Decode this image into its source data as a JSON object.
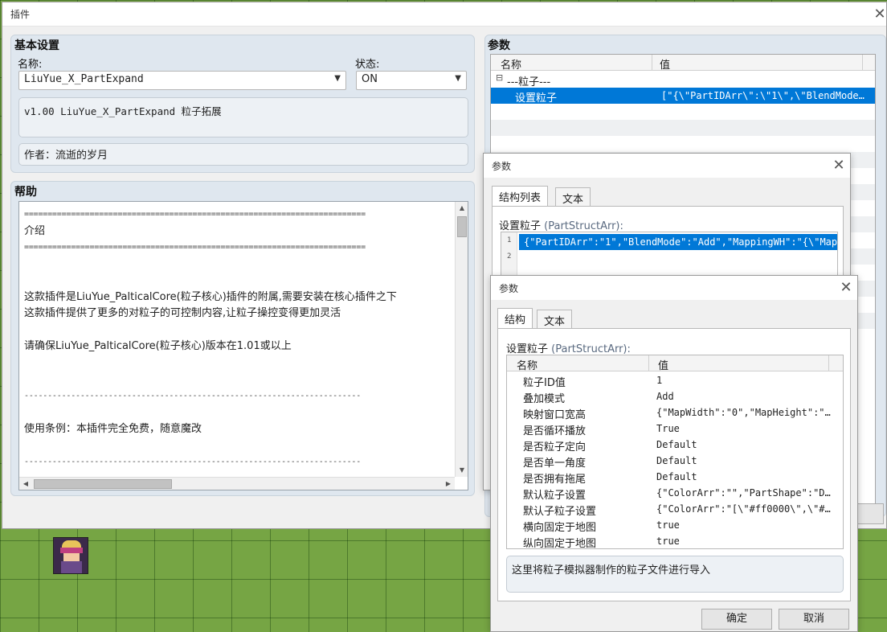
{
  "main_window": {
    "title": "插件",
    "basic": {
      "title": "基本设置",
      "name_label": "名称:",
      "name_value": "LiuYue_X_PartExpand",
      "status_label": "状态:",
      "status_value": "ON",
      "description": "v1.00 LiuYue_X_PartExpand 粒子拓展",
      "author": "作者：流逝的岁月"
    },
    "help": {
      "title": "帮助",
      "lines": [
        "=========================================================================",
        "介绍",
        "=========================================================================",
        "",
        "",
        "这款插件是LiuYue_PalticalCore(粒子核心)插件的附属,需要安装在核心插件之下",
        "这款插件提供了更多的对粒子的可控制内容,让粒子操控变得更加灵活",
        "",
        "请确保LiuYue_PalticalCore(粒子核心)版本在1.01或以上",
        "",
        "",
        "------------------------------------------------------------------------",
        "",
        "使用条例：本插件完全免费，随意魔改",
        "",
        "------------------------------------------------------------------------"
      ]
    },
    "params": {
      "title": "参数",
      "col_name": "名称",
      "col_value": "值",
      "group_label": "---粒子---",
      "group_toggle": "⊟",
      "row_name": "设置粒子",
      "row_value": "[\"{\\\"PartIDArr\\\":\\\"1\\\",\\\"BlendMode…"
    }
  },
  "dialog1": {
    "title": "参数",
    "tabs": [
      "结构列表",
      "文本"
    ],
    "field_label": "设置粒子",
    "field_type": "(PartStructArr):",
    "list": [
      {
        "num": "1",
        "text": "{\"PartIDArr\":\"1\",\"BlendMode\":\"Add\",\"MappingWH\":\"{\\\"Map…"
      },
      {
        "num": "2",
        "text": ""
      }
    ]
  },
  "dialog2": {
    "title": "参数",
    "tabs": [
      "结构",
      "文本"
    ],
    "field_label": "设置粒子",
    "field_type": "(PartStructArr):",
    "col_name": "名称",
    "col_value": "值",
    "rows": [
      {
        "name": "粒子ID值",
        "value": "1"
      },
      {
        "name": "叠加模式",
        "value": "Add"
      },
      {
        "name": "映射窗口宽高",
        "value": "{\"MapWidth\":\"0\",\"MapHeight\":\"…"
      },
      {
        "name": "是否循环播放",
        "value": "True"
      },
      {
        "name": "是否粒子定向",
        "value": "Default"
      },
      {
        "name": "是否单一角度",
        "value": "Default"
      },
      {
        "name": "是否拥有拖尾",
        "value": "Default"
      },
      {
        "name": "默认粒子设置",
        "value": "{\"ColorArr\":\"\",\"PartShape\":\"D…"
      },
      {
        "name": "默认子粒子设置",
        "value": "{\"ColorArr\":\"[\\\"#ff0000\\\",\\\"#…"
      },
      {
        "name": "横向固定于地图",
        "value": "true"
      },
      {
        "name": "纵向固定于地图",
        "value": "true"
      }
    ],
    "description": "这里将粒子模拟器制作的粒子文件进行导入",
    "ok_label": "确定",
    "cancel_label": "取消"
  },
  "colors": {
    "selection": "#0078d7",
    "group_bg": "#dfe7ef",
    "type_hint": "#5a6a80"
  }
}
